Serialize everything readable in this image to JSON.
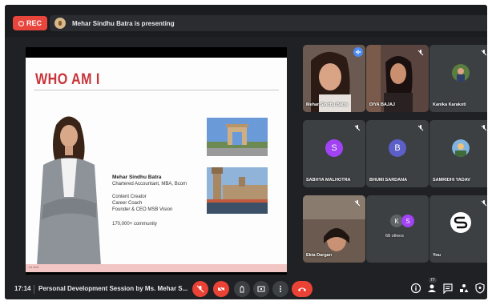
{
  "topbar": {
    "rec_label": "REC",
    "presenting_text": "Mehar Sindhu Batra is presenting"
  },
  "slide": {
    "title": "WHO AM I",
    "name": "Mehar Sindhu Batra",
    "lines": [
      "Chartered Accountant, MBA, Bcom",
      "Content Creator",
      "Career Coach",
      "Founder & CEO MSB Vision",
      "170,000+ community"
    ]
  },
  "participants": [
    {
      "name": "Mehar Sindhu Batra"
    },
    {
      "name": "DIYA BAJAJ"
    },
    {
      "name": "Kanika Karakoti"
    },
    {
      "name": "SABHYA MALHOTRA",
      "initial": "S"
    },
    {
      "name": "BHUMI SARDANA",
      "initial": "B"
    },
    {
      "name": "SAMRIDHI YADAV"
    },
    {
      "name": "Ekta Dargan"
    },
    {
      "name": "68 others",
      "initials": [
        "K",
        "S"
      ]
    },
    {
      "name": "You"
    }
  ],
  "bottombar": {
    "time": "17:14",
    "meeting_title": "Personal Development Session by Ms. Mehar S...",
    "people_count": "77"
  },
  "colors": {
    "rec": "#e8453c",
    "end_call": "#ea4335",
    "title_red": "#c8353a",
    "avatar_s": "#a142f4",
    "avatar_b": "#5b5fc7"
  }
}
